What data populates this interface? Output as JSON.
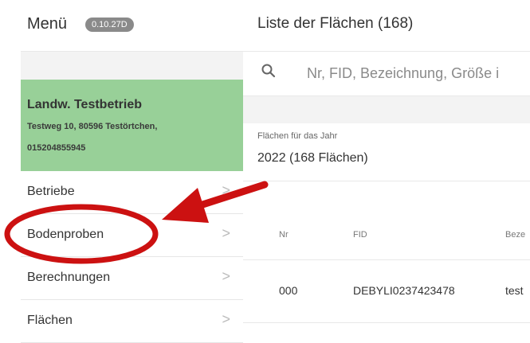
{
  "sidebar": {
    "title": "Menü",
    "version": "0.10.27D",
    "farm": {
      "name": "Landw. Testbetrieb",
      "address": "Testweg 10, 80596 Testörtchen,",
      "phone": "015204855945"
    },
    "items": [
      {
        "label": "Betriebe",
        "chevron": ">"
      },
      {
        "label": "Bodenproben",
        "chevron": ">"
      },
      {
        "label": "Berechnungen",
        "chevron": ">"
      },
      {
        "label": "Flächen",
        "chevron": ">"
      }
    ]
  },
  "main": {
    "title": "Liste der Flächen (168)",
    "search": {
      "placeholder": "Nr, FID, Bezeichnung, Größe i",
      "icon": "search-icon"
    },
    "year": {
      "caption": "Flächen für das Jahr",
      "value": "2022 (168 Flächen)"
    },
    "table": {
      "columns": [
        "Nr",
        "FID",
        "Beze"
      ],
      "rows": [
        {
          "nr": "000",
          "fid": "DEBYLI0237423478",
          "bez": "test"
        }
      ]
    }
  },
  "colors": {
    "farm_card": "#98d098",
    "annotation": "#cc1111",
    "version_badge": "#8a8a8a"
  }
}
